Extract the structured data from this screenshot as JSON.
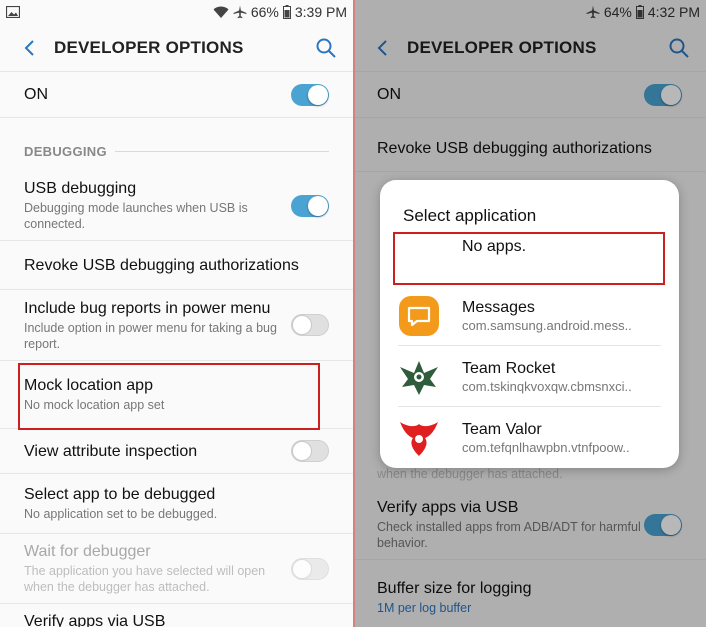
{
  "left": {
    "status": {
      "battery": "66%",
      "time": "3:39 PM"
    },
    "header": {
      "title": "DEVELOPER OPTIONS"
    },
    "master": {
      "label": "ON",
      "state": "on"
    },
    "section_debugging": "DEBUGGING",
    "items": [
      {
        "label": "USB debugging",
        "sub": "Debugging mode launches when USB is connected.",
        "toggle": "on"
      },
      {
        "label": "Revoke USB debugging authorizations"
      },
      {
        "label": "Include bug reports in power menu",
        "sub": "Include option in power menu for taking a bug report.",
        "toggle": "off"
      },
      {
        "label": "Mock location app",
        "sub": "No mock location app set"
      },
      {
        "label": "View attribute inspection",
        "toggle": "off"
      },
      {
        "label": "Select app to be debugged",
        "sub": "No application set to be debugged."
      },
      {
        "label": "Wait for debugger",
        "sub": "The application you have selected will open when the debugger has attached.",
        "toggle": "off",
        "disabled": true
      },
      {
        "label": "Verify apps via USB"
      }
    ]
  },
  "right": {
    "status": {
      "battery": "64%",
      "time": "4:32 PM"
    },
    "header": {
      "title": "DEVELOPER OPTIONS"
    },
    "master": {
      "label": "ON",
      "state": "on"
    },
    "items": [
      {
        "label": "Revoke USB debugging authorizations"
      },
      {
        "sub": "when the debugger has attached."
      },
      {
        "label": "Verify apps via USB",
        "sub": "Check installed apps from ADB/ADT for harmful behavior.",
        "toggle": "on"
      },
      {
        "label": "Buffer size for logging",
        "sub": "1M per log buffer"
      }
    ],
    "dialog": {
      "title": "Select application",
      "no_apps": "No apps.",
      "apps": [
        {
          "name": "Messages",
          "package": "com.samsung.android.mess..",
          "icon": "messages-icon"
        },
        {
          "name": "Team Rocket",
          "package": "com.tskinqkvoxqw.cbmsnxci..",
          "icon": "team-rocket-icon"
        },
        {
          "name": "Team Valor",
          "package": "com.tefqnlhawpbn.vtnfpoow..",
          "icon": "team-valor-icon"
        }
      ]
    }
  },
  "colors": {
    "accent": "#2b76c3",
    "toggle_on": "#4aa3d2",
    "highlight": "#cc2020",
    "messages_orange": "#f39a1b"
  }
}
